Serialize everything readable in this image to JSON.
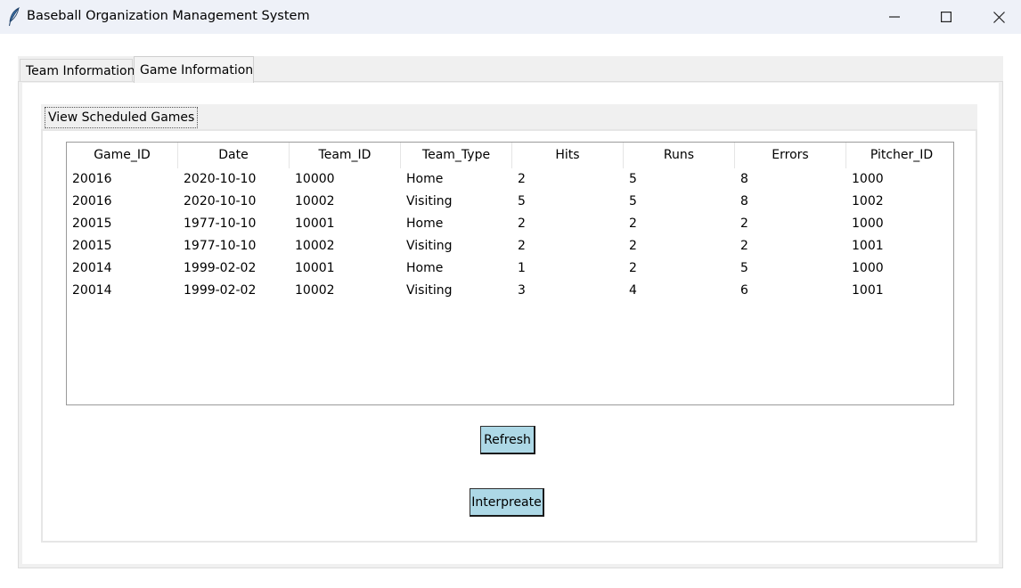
{
  "window": {
    "title": "Baseball Organization Management System",
    "controls": {
      "minimize": "—",
      "maximize": "☐",
      "close": "✕"
    }
  },
  "outer_tabs": [
    {
      "label": "Team Information",
      "selected": false
    },
    {
      "label": "Game Information",
      "selected": true
    }
  ],
  "inner_tabs": [
    {
      "label": "View Scheduled Games",
      "selected": true
    }
  ],
  "table": {
    "columns": [
      "Game_ID",
      "Date",
      "Team_ID",
      "Team_Type",
      "Hits",
      "Runs",
      "Errors",
      "Pitcher_ID"
    ],
    "rows": [
      [
        "20016",
        "2020-10-10",
        "10000",
        "Home",
        "2",
        "5",
        "8",
        "1000"
      ],
      [
        "20016",
        "2020-10-10",
        "10002",
        "Visiting",
        "5",
        "5",
        "8",
        "1002"
      ],
      [
        "20015",
        "1977-10-10",
        "10001",
        "Home",
        "2",
        "2",
        "2",
        "1000"
      ],
      [
        "20015",
        "1977-10-10",
        "10002",
        "Visiting",
        "2",
        "2",
        "2",
        "1001"
      ],
      [
        "20014",
        "1999-02-02",
        "10001",
        "Home",
        "1",
        "2",
        "5",
        "1000"
      ],
      [
        "20014",
        "1999-02-02",
        "10002",
        "Visiting",
        "3",
        "4",
        "6",
        "1001"
      ]
    ]
  },
  "buttons": {
    "refresh": "Refresh",
    "interpret": "Interpreate"
  },
  "colors": {
    "button_bg": "#add8e6",
    "titlebar_bg": "#eef1f8",
    "tab_bg": "#f0f0f0"
  },
  "icons": {
    "app": "feather-icon",
    "minimize": "minimize-icon",
    "maximize": "maximize-icon",
    "close": "close-icon"
  }
}
